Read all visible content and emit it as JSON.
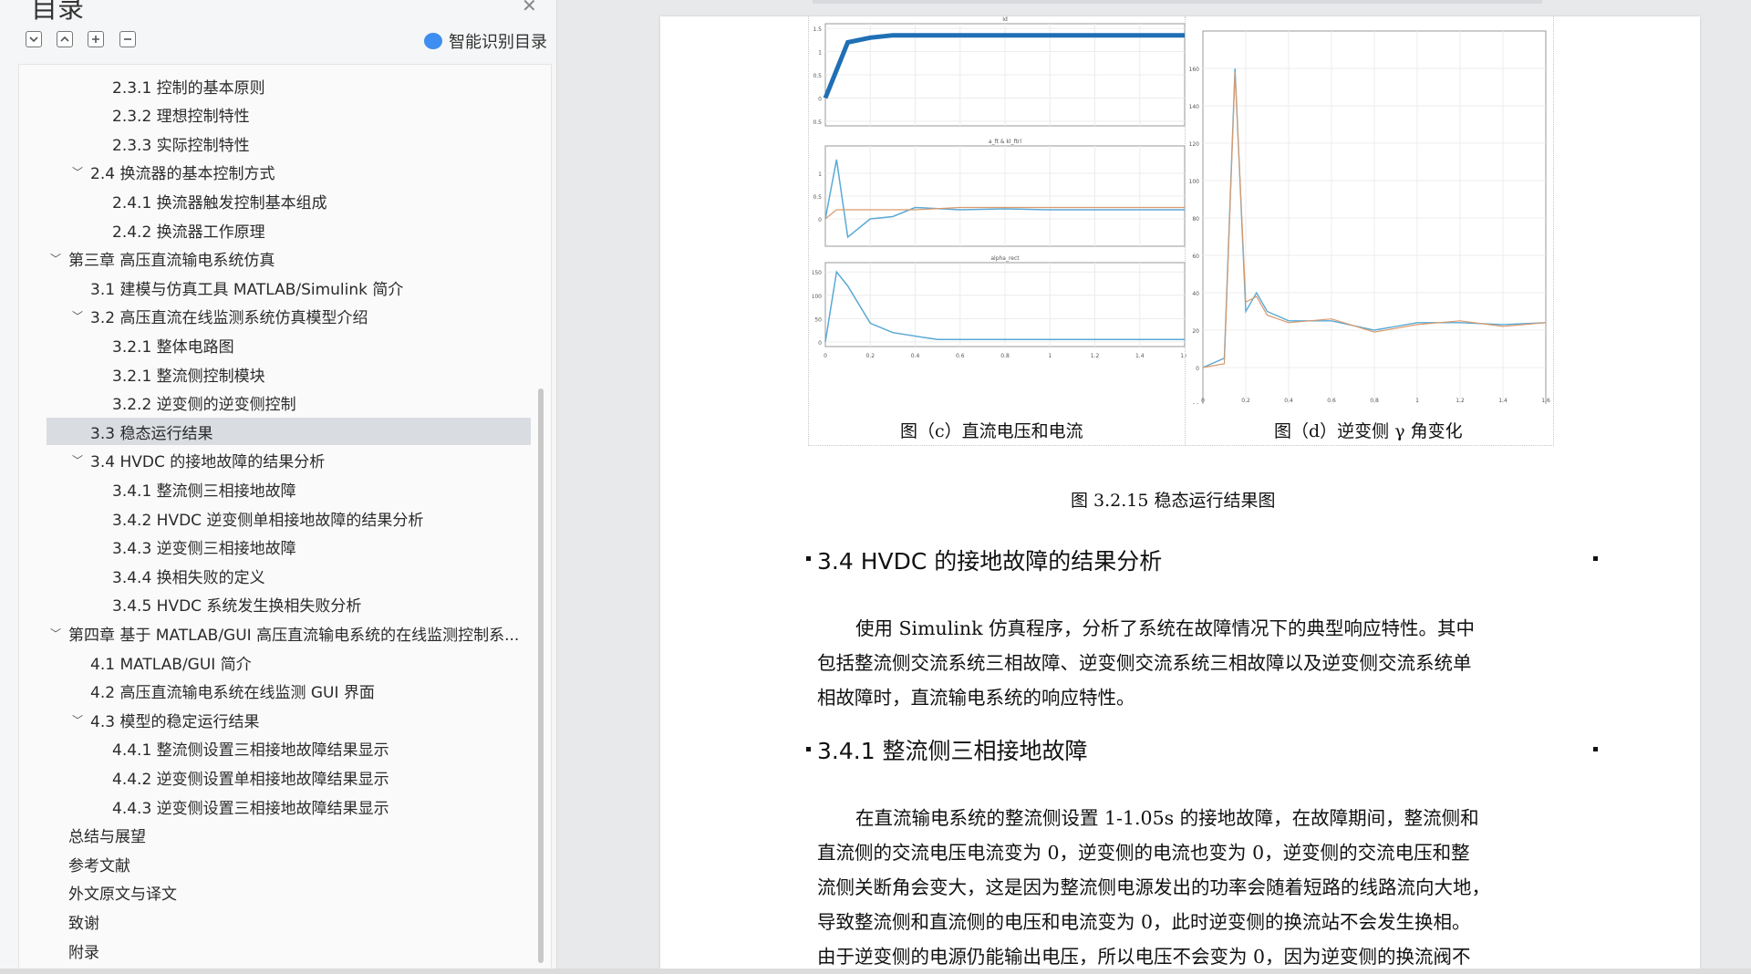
{
  "sidebar": {
    "title": "目录",
    "close_icon": "close-icon",
    "tools": [
      "expand-all-icon",
      "collapse-all-icon",
      "plus-icon",
      "minus-icon"
    ],
    "smart_toc_label": "智能识别目录",
    "items": [
      {
        "label": "2.3.1 控制的基本原则",
        "level": 2
      },
      {
        "label": "2.3.2  理想控制特性",
        "level": 2
      },
      {
        "label": "2.3.3  实际控制特性",
        "level": 2
      },
      {
        "label": "2.4  换流器的基本控制方式",
        "level": 1,
        "expanded": true
      },
      {
        "label": "2.4.1 换流器触发控制基本组成",
        "level": 2
      },
      {
        "label": "2.4.2 换流器工作原理",
        "level": 2
      },
      {
        "label": "第三章  高压直流输电系统仿真",
        "level": 0,
        "expanded": true
      },
      {
        "label": "3.1  建模与仿真工具 MATLAB/Simulink 简介",
        "level": 1
      },
      {
        "label": "3.2 高压直流在线监测系统仿真模型介绍",
        "level": 1,
        "expanded": true
      },
      {
        "label": "3.2.1 整体电路图",
        "level": 2
      },
      {
        "label": "3.2.1  整流侧控制模块",
        "level": 2
      },
      {
        "label": "3.2.2  逆变侧的逆变侧控制",
        "level": 2
      },
      {
        "label": "3.3  稳态运行结果",
        "level": 1,
        "active": true
      },
      {
        "label": "3.4 HVDC 的接地故障的结果分析",
        "level": 1,
        "expanded": true
      },
      {
        "label": "3.4.1  整流侧三相接地故障",
        "level": 2
      },
      {
        "label": "3.4.2 HVDC 逆变侧单相接地故障的结果分析",
        "level": 2
      },
      {
        "label": "3.4.3  逆变侧三相接地故障",
        "level": 2
      },
      {
        "label": "3.4.4  换相失败的定义",
        "level": 2
      },
      {
        "label": "3.4.5  HVDC 系统发生换相失败分析",
        "level": 2
      },
      {
        "label": "第四章  基于 MATLAB/GUI 高压直流输电系统的在线监测控制系...",
        "level": 0,
        "expanded": true
      },
      {
        "label": "4.1 MATLAB/GUI 简介",
        "level": 1
      },
      {
        "label": "4.2 高压直流输电系统在线监测 GUI 界面",
        "level": 1
      },
      {
        "label": "4.3  模型的稳定运行结果",
        "level": 1,
        "expanded": true
      },
      {
        "label": "4.4.1  整流侧设置三相接地故障结果显示",
        "level": 2
      },
      {
        "label": "4.4.2  逆变侧设置单相接地故障结果显示",
        "level": 2
      },
      {
        "label": "4.4.3  逆变侧设置三相接地故障结果显示",
        "level": 2
      },
      {
        "label": "总结与展望",
        "level": 0
      },
      {
        "label": "参考文献",
        "level": 0
      },
      {
        "label": "外文原文与译文",
        "level": 0
      },
      {
        "label": "致谢",
        "level": 0
      },
      {
        "label": "附录",
        "level": 0
      }
    ]
  },
  "document": {
    "caption_c": "图（c）直流电压和电流",
    "caption_d": "图（d）逆变侧 γ 角变化",
    "figure_caption": "图 3.2.15 稳态运行结果图",
    "section_heading": "3.4 HVDC 的接地故障的结果分析",
    "section_para": [
      "使用 Simulink 仿真程序，分析了系统在故障情况下的典型响应特性。其中",
      "包括整流侧交流系统三相故障、逆变侧交流系统三相故障以及逆变侧交流系统单",
      "相故障时，直流输电系统的响应特性。"
    ],
    "subsection_heading": "3.4.1 整流侧三相接地故障",
    "subsection_para": [
      "在直流输电系统的整流侧设置 1-1.05s 的接地故障，在故障期间，整流侧和",
      "直流侧的交流电压电流变为 0，逆变侧的电流也变为 0，逆变侧的交流电压和整",
      "流侧关断角会变大，这是因为整流侧电源发出的功率会随着短路的线路流向大地，",
      "导致整流侧和直流侧的电压和电流变为 0，此时逆变侧的换流站不会发生换相。",
      "由于逆变侧的电源仍能输出电压，所以电压不会变为 0，因为逆变侧的换流阀不"
    ]
  },
  "chart_data": [
    {
      "type": "line",
      "title": "Id",
      "series": [
        {
          "x": [
            0,
            0.05,
            0.1,
            0.2,
            0.3,
            0.4,
            0.6,
            0.8,
            1.0,
            1.2,
            1.4,
            1.6
          ],
          "y": [
            0,
            0.6,
            1.2,
            1.3,
            1.35,
            1.35,
            1.35,
            1.35,
            1.35,
            1.35,
            1.35,
            1.35
          ]
        }
      ],
      "color": "#1f6fb5"
    },
    {
      "type": "line",
      "title": "a_ft & kl_ftrl",
      "series": [
        {
          "x": [
            0,
            0.05,
            0.1,
            0.2,
            0.3,
            0.4,
            0.6,
            0.8,
            1.0,
            1.6
          ],
          "y": [
            0,
            1.3,
            -0.4,
            0.0,
            0.05,
            0.25,
            0.2,
            0.22,
            0.2,
            0.2
          ]
        },
        {
          "x": [
            0,
            0.05,
            0.1,
            0.4,
            0.6,
            1.6
          ],
          "y": [
            0,
            0.2,
            0.2,
            0.2,
            0.25,
            0.25
          ]
        }
      ]
    },
    {
      "type": "line",
      "title": "alpha_rect",
      "series": [
        {
          "x": [
            0,
            0.05,
            0.1,
            0.2,
            0.3,
            0.5,
            0.8,
            1.2,
            1.6
          ],
          "y": [
            0,
            150,
            120,
            40,
            20,
            5,
            5,
            5,
            5
          ]
        }
      ]
    },
    {
      "type": "line",
      "title": "",
      "series": [
        {
          "x": [
            0,
            0.1,
            0.15,
            0.2,
            0.25,
            0.3,
            0.4,
            0.6,
            0.8,
            1.0,
            1.2,
            1.4,
            1.6
          ],
          "y": [
            0,
            5,
            160,
            30,
            40,
            30,
            25,
            25,
            20,
            24,
            24,
            23,
            24
          ]
        },
        {
          "x": [
            0,
            0.1,
            0.15,
            0.2,
            0.25,
            0.3,
            0.4,
            0.6,
            0.8,
            1.0,
            1.2,
            1.4,
            1.6
          ],
          "y": [
            0,
            2,
            158,
            35,
            38,
            28,
            24,
            26,
            19,
            23,
            25,
            22,
            24
          ]
        }
      ],
      "ylim": [
        -20,
        180
      ]
    }
  ]
}
